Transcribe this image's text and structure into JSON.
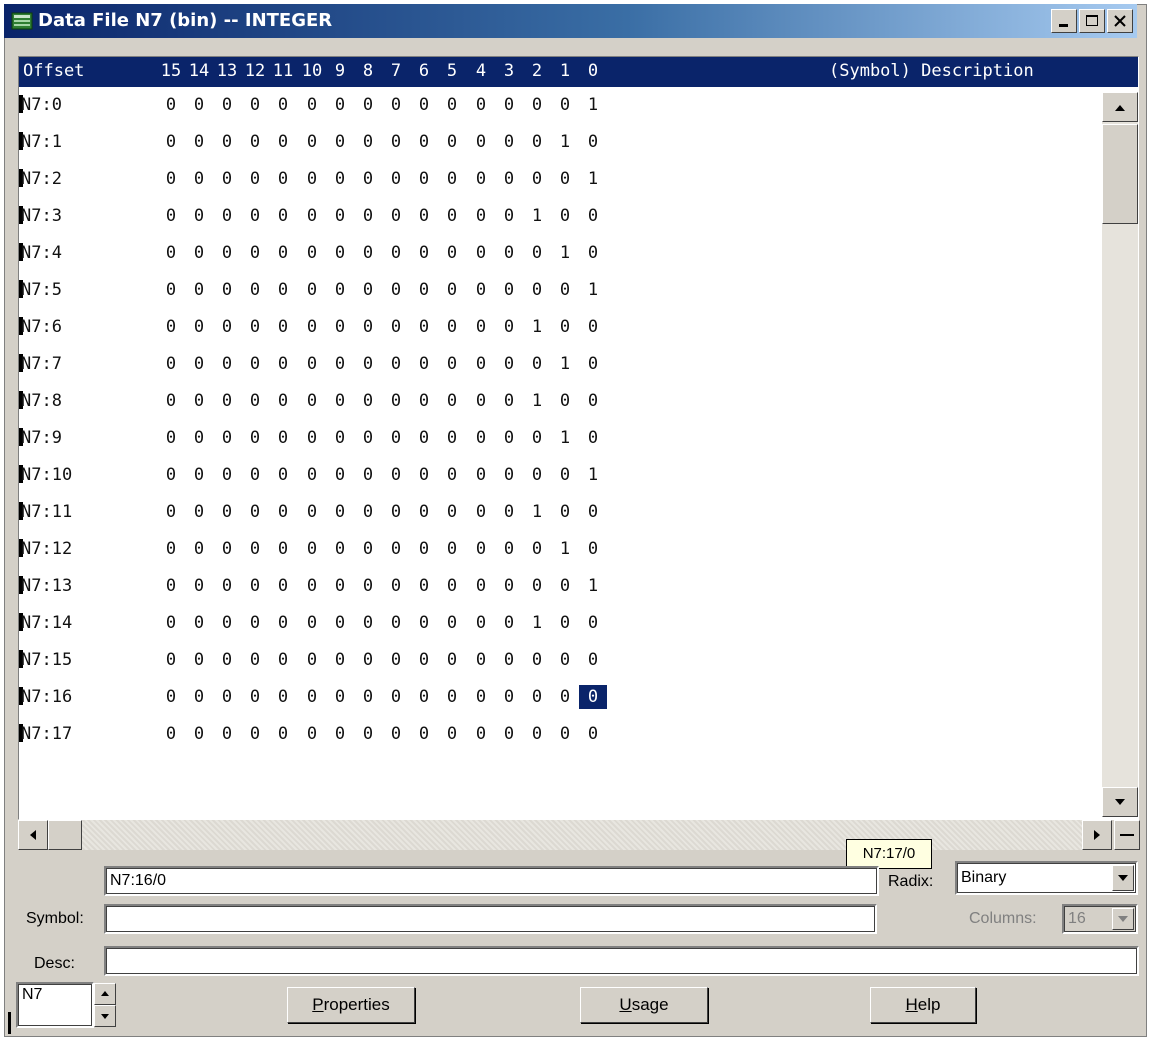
{
  "window": {
    "title": "Data File N7 (bin) -- INTEGER",
    "controls": [
      "minimize",
      "maximize",
      "close"
    ]
  },
  "table": {
    "offset_header": "Offset",
    "bit_headers": [
      "15",
      "14",
      "13",
      "12",
      "11",
      "10",
      "9",
      "8",
      "7",
      "6",
      "5",
      "4",
      "3",
      "2",
      "1",
      "0"
    ],
    "description_header": "(Symbol) Description",
    "rows": [
      {
        "offset": "N7:0",
        "bits": [
          "0",
          "0",
          "0",
          "0",
          "0",
          "0",
          "0",
          "0",
          "0",
          "0",
          "0",
          "0",
          "0",
          "0",
          "0",
          "1"
        ]
      },
      {
        "offset": "N7:1",
        "bits": [
          "0",
          "0",
          "0",
          "0",
          "0",
          "0",
          "0",
          "0",
          "0",
          "0",
          "0",
          "0",
          "0",
          "0",
          "1",
          "0"
        ]
      },
      {
        "offset": "N7:2",
        "bits": [
          "0",
          "0",
          "0",
          "0",
          "0",
          "0",
          "0",
          "0",
          "0",
          "0",
          "0",
          "0",
          "0",
          "0",
          "0",
          "1"
        ]
      },
      {
        "offset": "N7:3",
        "bits": [
          "0",
          "0",
          "0",
          "0",
          "0",
          "0",
          "0",
          "0",
          "0",
          "0",
          "0",
          "0",
          "0",
          "1",
          "0",
          "0"
        ]
      },
      {
        "offset": "N7:4",
        "bits": [
          "0",
          "0",
          "0",
          "0",
          "0",
          "0",
          "0",
          "0",
          "0",
          "0",
          "0",
          "0",
          "0",
          "0",
          "1",
          "0"
        ]
      },
      {
        "offset": "N7:5",
        "bits": [
          "0",
          "0",
          "0",
          "0",
          "0",
          "0",
          "0",
          "0",
          "0",
          "0",
          "0",
          "0",
          "0",
          "0",
          "0",
          "1"
        ]
      },
      {
        "offset": "N7:6",
        "bits": [
          "0",
          "0",
          "0",
          "0",
          "0",
          "0",
          "0",
          "0",
          "0",
          "0",
          "0",
          "0",
          "0",
          "1",
          "0",
          "0"
        ]
      },
      {
        "offset": "N7:7",
        "bits": [
          "0",
          "0",
          "0",
          "0",
          "0",
          "0",
          "0",
          "0",
          "0",
          "0",
          "0",
          "0",
          "0",
          "0",
          "1",
          "0"
        ]
      },
      {
        "offset": "N7:8",
        "bits": [
          "0",
          "0",
          "0",
          "0",
          "0",
          "0",
          "0",
          "0",
          "0",
          "0",
          "0",
          "0",
          "0",
          "1",
          "0",
          "0"
        ]
      },
      {
        "offset": "N7:9",
        "bits": [
          "0",
          "0",
          "0",
          "0",
          "0",
          "0",
          "0",
          "0",
          "0",
          "0",
          "0",
          "0",
          "0",
          "0",
          "1",
          "0"
        ]
      },
      {
        "offset": "N7:10",
        "bits": [
          "0",
          "0",
          "0",
          "0",
          "0",
          "0",
          "0",
          "0",
          "0",
          "0",
          "0",
          "0",
          "0",
          "0",
          "0",
          "1"
        ]
      },
      {
        "offset": "N7:11",
        "bits": [
          "0",
          "0",
          "0",
          "0",
          "0",
          "0",
          "0",
          "0",
          "0",
          "0",
          "0",
          "0",
          "0",
          "1",
          "0",
          "0"
        ]
      },
      {
        "offset": "N7:12",
        "bits": [
          "0",
          "0",
          "0",
          "0",
          "0",
          "0",
          "0",
          "0",
          "0",
          "0",
          "0",
          "0",
          "0",
          "0",
          "1",
          "0"
        ]
      },
      {
        "offset": "N7:13",
        "bits": [
          "0",
          "0",
          "0",
          "0",
          "0",
          "0",
          "0",
          "0",
          "0",
          "0",
          "0",
          "0",
          "0",
          "0",
          "0",
          "1"
        ]
      },
      {
        "offset": "N7:14",
        "bits": [
          "0",
          "0",
          "0",
          "0",
          "0",
          "0",
          "0",
          "0",
          "0",
          "0",
          "0",
          "0",
          "0",
          "1",
          "0",
          "0"
        ]
      },
      {
        "offset": "N7:15",
        "bits": [
          "0",
          "0",
          "0",
          "0",
          "0",
          "0",
          "0",
          "0",
          "0",
          "0",
          "0",
          "0",
          "0",
          "0",
          "0",
          "0"
        ]
      },
      {
        "offset": "N7:16",
        "bits": [
          "0",
          "0",
          "0",
          "0",
          "0",
          "0",
          "0",
          "0",
          "0",
          "0",
          "0",
          "0",
          "0",
          "0",
          "0",
          "0"
        ]
      },
      {
        "offset": "N7:17",
        "bits": [
          "0",
          "0",
          "0",
          "0",
          "0",
          "0",
          "0",
          "0",
          "0",
          "0",
          "0",
          "0",
          "0",
          "0",
          "0",
          "0"
        ]
      }
    ],
    "selected_cell": {
      "row": 16,
      "bit_index": 15
    }
  },
  "tooltip": "N7:17/0",
  "address_field": "N7:16/0",
  "radix": {
    "label": "Radix:",
    "value": "Binary"
  },
  "symbol": {
    "label": "Symbol:",
    "value": ""
  },
  "columns": {
    "label": "Columns:",
    "value": "16"
  },
  "desc": {
    "label": "Desc:",
    "value": ""
  },
  "file_spinner": {
    "value": "N7"
  },
  "buttons": {
    "properties": {
      "mnemonic": "P",
      "rest": "roperties"
    },
    "usage": {
      "mnemonic": "U",
      "rest": "sage"
    },
    "help": {
      "mnemonic": "H",
      "rest": "elp"
    }
  },
  "colors": {
    "header_bg": "#0a246a",
    "selection_bg": "#0a246a",
    "face": "#d4d0c8",
    "tooltip_bg": "#ffffe1"
  }
}
